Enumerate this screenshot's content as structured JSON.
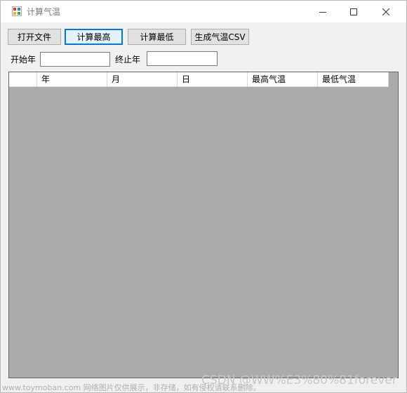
{
  "window": {
    "title": "计算气温"
  },
  "toolbar": {
    "open_file": "打开文件",
    "calc_max": "计算最高",
    "calc_min": "计算最低",
    "gen_csv": "生成气温CSV"
  },
  "filters": {
    "start_year_label": "开始年",
    "start_year_value": "",
    "end_year_label": "终止年",
    "end_year_value": ""
  },
  "grid": {
    "columns": [
      "",
      "年",
      "月",
      "日",
      "最高气温",
      "最低气温"
    ],
    "rows": []
  },
  "watermark": {
    "line1": "www.toymoban.com 网络图片仅供展示，非存储，如有侵权请联系删除。",
    "line2": "CSDN @WW%E3%80%81forever"
  },
  "colors": {
    "focus_border": "#0078d7",
    "grid_background": "#ababab",
    "window_background": "#f0f0f0"
  }
}
